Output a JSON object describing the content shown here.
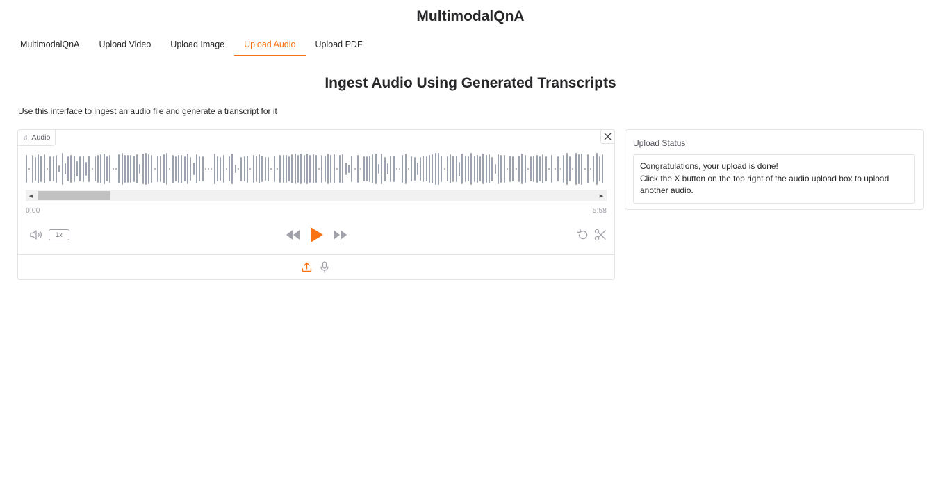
{
  "app": {
    "title": "MultimodalQnA"
  },
  "tabs": [
    {
      "label": "MultimodalQnA",
      "active": false
    },
    {
      "label": "Upload Video",
      "active": false
    },
    {
      "label": "Upload Image",
      "active": false
    },
    {
      "label": "Upload Audio",
      "active": true
    },
    {
      "label": "Upload PDF",
      "active": false
    }
  ],
  "main": {
    "title": "Ingest Audio Using Generated Transcripts",
    "description": "Use this interface to ingest an audio file and generate a transcript for it"
  },
  "audio_player": {
    "label": "Audio",
    "current_time": "0:00",
    "duration": "5:58",
    "playback_speed": "1x",
    "scroll_position": 0.0,
    "icons": {
      "label": "music-note-icon",
      "clear": "close-icon",
      "volume": "volume-icon",
      "rewind": "rewind-icon",
      "play": "play-icon",
      "forward": "fast-forward-icon",
      "reset": "undo-icon",
      "trim": "scissors-icon",
      "upload": "upload-icon",
      "microphone": "microphone-icon"
    }
  },
  "upload_status": {
    "label": "Upload Status",
    "message_line1": "Congratulations, your upload is done!",
    "message_line2": "Click the X button on the top right of the audio upload box to upload another audio."
  },
  "colors": {
    "accent": "#f97316",
    "waveform": "#9ca3af",
    "border": "#e4e4e7"
  }
}
